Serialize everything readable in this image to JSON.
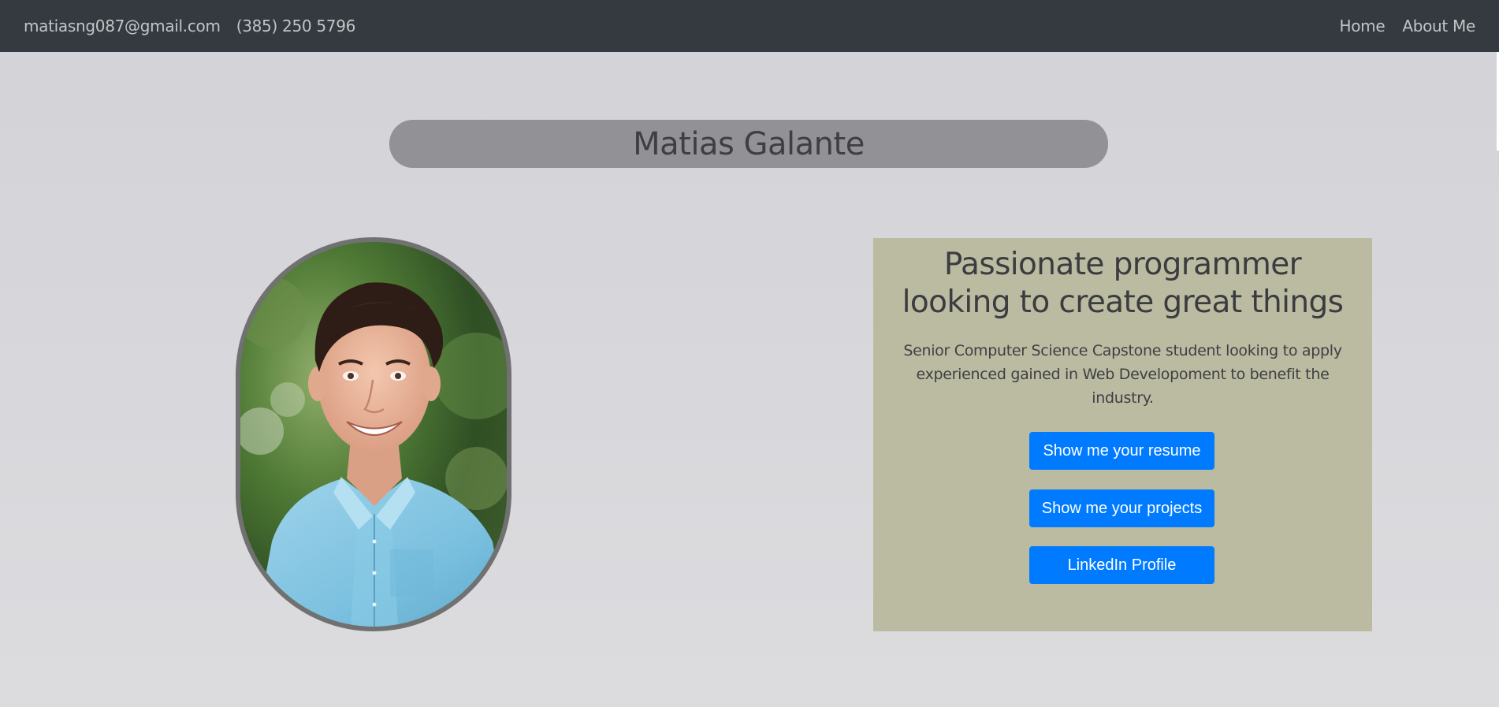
{
  "navbar": {
    "email": "matiasng087@gmail.com",
    "phone": "(385) 250 5796",
    "links": [
      {
        "label": "Home"
      },
      {
        "label": "About Me"
      }
    ]
  },
  "hero": {
    "name": "Matias Galante"
  },
  "intro": {
    "headline": "Passionate programmer looking to create great things",
    "description": "Senior Computer Science Capstone student looking to apply experienced gained in Web Developoment to benefit the industry.",
    "buttons": {
      "resume": "Show me your resume",
      "projects": "Show me your projects",
      "linkedin": "LinkedIn Profile"
    }
  },
  "colors": {
    "navbar_bg": "#343a40",
    "page_bg": "#d4d3d8",
    "pill_bg": "#929296",
    "card_bg": "#babba0",
    "button_primary": "#007bff"
  },
  "icons": {
    "portrait": "profile-photo"
  }
}
